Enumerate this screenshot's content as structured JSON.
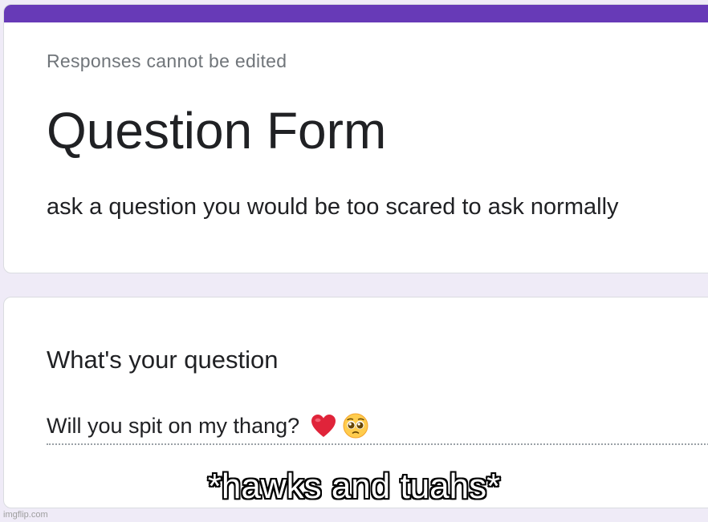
{
  "colors": {
    "accent": "#673ab7",
    "background": "#efebf7",
    "card": "#ffffff"
  },
  "form": {
    "responses_note": "Responses cannot be edited",
    "title": "Question Form",
    "description": "ask a question you would be too scared to ask normally"
  },
  "question": {
    "label": "What's your question",
    "answer": "Will you spit on my thang?",
    "emoji_icons": [
      "heart-icon",
      "pleading-face-icon"
    ]
  },
  "meme": {
    "caption": "*hawks and tuahs*",
    "watermark": "imgflip.com"
  }
}
